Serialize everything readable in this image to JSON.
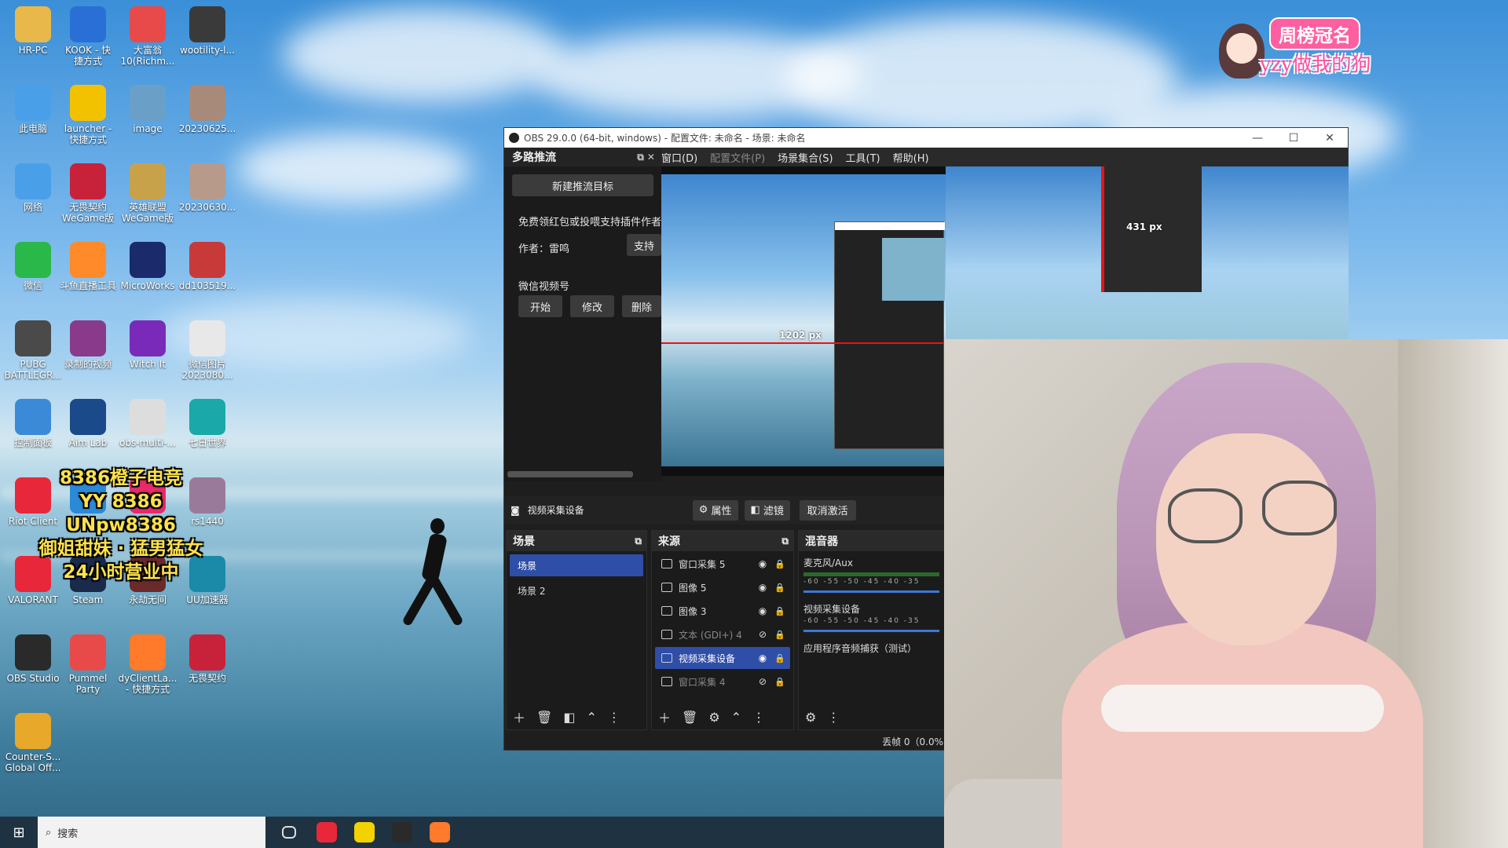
{
  "desktop": {
    "icons": [
      {
        "label": "HR-PC",
        "icon": "user-folder-icon",
        "color": "#e8b84a"
      },
      {
        "label": "KOOK - 快\n捷方式",
        "icon": "kook-app-icon",
        "color": "#2a6fd6"
      },
      {
        "label": "大富翁\n10(Richm...",
        "icon": "richman-game-icon",
        "color": "#e84a4a"
      },
      {
        "label": "wootility-l...",
        "icon": "wootility-icon",
        "color": "#3a3a3a"
      },
      {
        "label": "此电脑",
        "icon": "this-pc-icon",
        "color": "#4aa0e8"
      },
      {
        "label": "launcher -\n快捷方式",
        "icon": "launcher-icon",
        "color": "#f2c200"
      },
      {
        "label": "image",
        "icon": "image-file-icon",
        "color": "#6aa0c8"
      },
      {
        "label": "20230625...",
        "icon": "photo-thumb-icon",
        "color": "#a88a7a"
      },
      {
        "label": "网络",
        "icon": "network-icon",
        "color": "#4aa0e8"
      },
      {
        "label": "无畏契约\nWeGame版",
        "icon": "valorant-wegame-icon",
        "color": "#c8223a"
      },
      {
        "label": "英雄联盟\nWeGame版",
        "icon": "lol-wegame-icon",
        "color": "#c8a24a"
      },
      {
        "label": "20230630...",
        "icon": "photo-thumb-icon",
        "color": "#b89a8a"
      },
      {
        "label": "微信",
        "icon": "wechat-icon",
        "color": "#2ab84a"
      },
      {
        "label": "斗鱼直播工具",
        "icon": "douyu-icon",
        "color": "#ff8a2a"
      },
      {
        "label": "MicroWorks",
        "icon": "microworks-icon",
        "color": "#1a2a6a"
      },
      {
        "label": "dd103519...",
        "icon": "file-thumb-icon",
        "color": "#c83a3a"
      },
      {
        "label": "PUBG\nBATTLEGR...",
        "icon": "pubg-icon",
        "color": "#4a4a4a"
      },
      {
        "label": "录制的视频",
        "icon": "winrar-icon",
        "color": "#8a3a8a"
      },
      {
        "label": "Witch It",
        "icon": "witch-it-icon",
        "color": "#7a2ab8"
      },
      {
        "label": "微信图片\n2023080...",
        "icon": "image-file-icon",
        "color": "#e8e8e8"
      },
      {
        "label": "控制面板",
        "icon": "control-panel-icon",
        "color": "#3a8ad8"
      },
      {
        "label": "Aim Lab",
        "icon": "aimlab-icon",
        "color": "#1a4a8a"
      },
      {
        "label": "obs-multi-...",
        "icon": "obs-multi-installer-icon",
        "color": "#dddddd"
      },
      {
        "label": "七日世界",
        "icon": "game-icon",
        "color": "#1aa8a8"
      },
      {
        "label": "Riot Client",
        "icon": "riot-client-icon",
        "color": "#e8283a"
      },
      {
        "label": "",
        "icon": "qq-music-icon",
        "color": "#2a8ad8"
      },
      {
        "label": "",
        "icon": "app-icon",
        "color": "#e82a6a"
      },
      {
        "label": "rs1440",
        "icon": "photo-thumb-icon",
        "color": "#9a7a9a"
      },
      {
        "label": "VALORANT",
        "icon": "valorant-icon",
        "color": "#e8283a"
      },
      {
        "label": "Steam",
        "icon": "steam-icon",
        "color": "#1a2a4a"
      },
      {
        "label": "永劫无间",
        "icon": "naraka-icon",
        "color": "#6a2a2a"
      },
      {
        "label": "UU加速器",
        "icon": "uu-accelerator-icon",
        "color": "#1a8aa8"
      },
      {
        "label": "OBS Studio",
        "icon": "obs-studio-icon",
        "color": "#2a2a2a"
      },
      {
        "label": "Pummel\nParty",
        "icon": "pummel-party-icon",
        "color": "#e84a4a"
      },
      {
        "label": "dyClientLa...\n- 快捷方式",
        "icon": "douyu-client-icon",
        "color": "#ff7a2a"
      },
      {
        "label": "无畏契约",
        "icon": "valorant-cn-icon",
        "color": "#c8223a"
      },
      {
        "label": "Counter-S...\nGlobal Off...",
        "icon": "csgo-icon",
        "color": "#e8a82a"
      }
    ]
  },
  "promo": {
    "lines": [
      "8386橙子电竞",
      "YY 8386",
      "UNpw8386",
      "御姐甜妹 · 猛男猛女",
      "24小时营业中"
    ]
  },
  "badge": {
    "crown_text": "周榜冠名",
    "name_text": "yzy做我的狗"
  },
  "obs": {
    "title": "OBS 29.0.0 (64-bit, windows) - 配置文件: 未命名 - 场景: 未命名",
    "window_buttons": {
      "minimize": "—",
      "maximize": "☐",
      "close": "✕"
    },
    "menu": [
      {
        "label": "窗口(D)",
        "dim": false
      },
      {
        "label": "配置文件(P)",
        "dim": true
      },
      {
        "label": "场景集合(S)",
        "dim": false
      },
      {
        "label": "工具(T)",
        "dim": false
      },
      {
        "label": "帮助(H)",
        "dim": false
      }
    ],
    "multi_dock": {
      "title": "多路推流",
      "new_target_btn": "新建推流目标",
      "promo_text": "免费领红包或投喂支持插件作者",
      "author_label": "作者：雷鸣",
      "support_btn": "支持",
      "target_name": "微信视频号",
      "start_btn": "开始",
      "edit_btn": "修改",
      "delete_btn": "删除"
    },
    "preview": {
      "measure_h": "1202 px",
      "measure_v": "431 px"
    },
    "source_bar": {
      "source_name": "视频采集设备",
      "properties_btn": "属性",
      "filters_btn": "滤镜",
      "deactivate_btn": "取消激活"
    },
    "scenes": {
      "title": "场景",
      "items": [
        {
          "label": "场景",
          "active": true
        },
        {
          "label": "场景 2",
          "active": false
        }
      ]
    },
    "sources": {
      "title": "来源",
      "items": [
        {
          "label": "窗口采集 5",
          "visible": true,
          "active": false
        },
        {
          "label": "图像 5",
          "visible": true,
          "active": false
        },
        {
          "label": "图像 3",
          "visible": true,
          "active": false
        },
        {
          "label": "文本 (GDI+) 4",
          "visible": false,
          "active": false
        },
        {
          "label": "视频采集设备",
          "visible": true,
          "active": true
        },
        {
          "label": "窗口采集 4",
          "visible": false,
          "active": false
        }
      ]
    },
    "mixer": {
      "title": "混音器",
      "channels": [
        {
          "label": "麦克风/Aux",
          "ticks": "-60 -55 -50 -45 -40 -35"
        },
        {
          "label": "视频采集设备",
          "ticks": "-60 -55 -50 -45 -40 -35"
        },
        {
          "label": "应用程序音频捕获（测试）",
          "ticks": ""
        }
      ]
    },
    "status": "丢帧 0（0.0%"
  },
  "taskbar": {
    "search_placeholder": "搜索",
    "apps": [
      {
        "icon": "task-view-icon",
        "color": "#1f3242"
      },
      {
        "icon": "netease-music-icon",
        "color": "#e8283a"
      },
      {
        "icon": "app-ring-icon",
        "color": "#f2d200"
      },
      {
        "icon": "obs-taskbar-icon",
        "color": "#2a2a2a"
      },
      {
        "icon": "douyu-taskbar-icon",
        "color": "#ff7a2a"
      }
    ]
  }
}
